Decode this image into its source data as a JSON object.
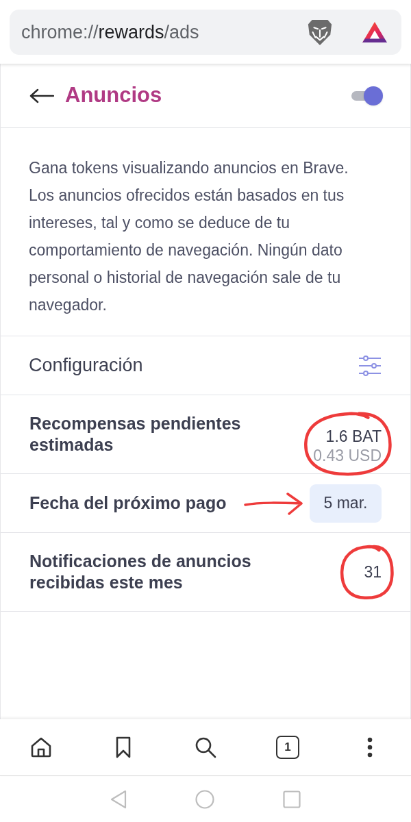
{
  "address_bar": {
    "url_parts": [
      {
        "text": "chrome://",
        "emphasis": false
      },
      {
        "text": "rewards",
        "emphasis": true
      },
      {
        "text": "/ads",
        "emphasis": false
      }
    ]
  },
  "header": {
    "title": "Anuncios",
    "toggle": {
      "on": true
    }
  },
  "description": "Gana tokens visualizando anuncios en Brave. Los anuncios ofrecidos están basados en tus intereses, tal y como se deduce de tu comportamiento de navegación. Ningún dato personal o historial de navegación sale de tu navegador.",
  "settings_row": {
    "label": "Configuración"
  },
  "stats": [
    {
      "label": "Recompensas pendientes estimadas",
      "kind": "amount",
      "value": "1.6 BAT",
      "secondary": "0.43 USD",
      "circled": true,
      "arrow": false
    },
    {
      "label": "Fecha del próximo pago",
      "kind": "pill",
      "value": "5 mar.",
      "circled": false,
      "arrow": true
    },
    {
      "label": "Notificaciones de anuncios recibidas este mes",
      "kind": "plain",
      "value": "31",
      "circled": true,
      "arrow": false
    }
  ],
  "bottom_nav": [
    {
      "kind": "home"
    },
    {
      "kind": "bookmarks"
    },
    {
      "kind": "search"
    },
    {
      "kind": "tabs",
      "count": "1"
    },
    {
      "kind": "menu"
    }
  ]
}
